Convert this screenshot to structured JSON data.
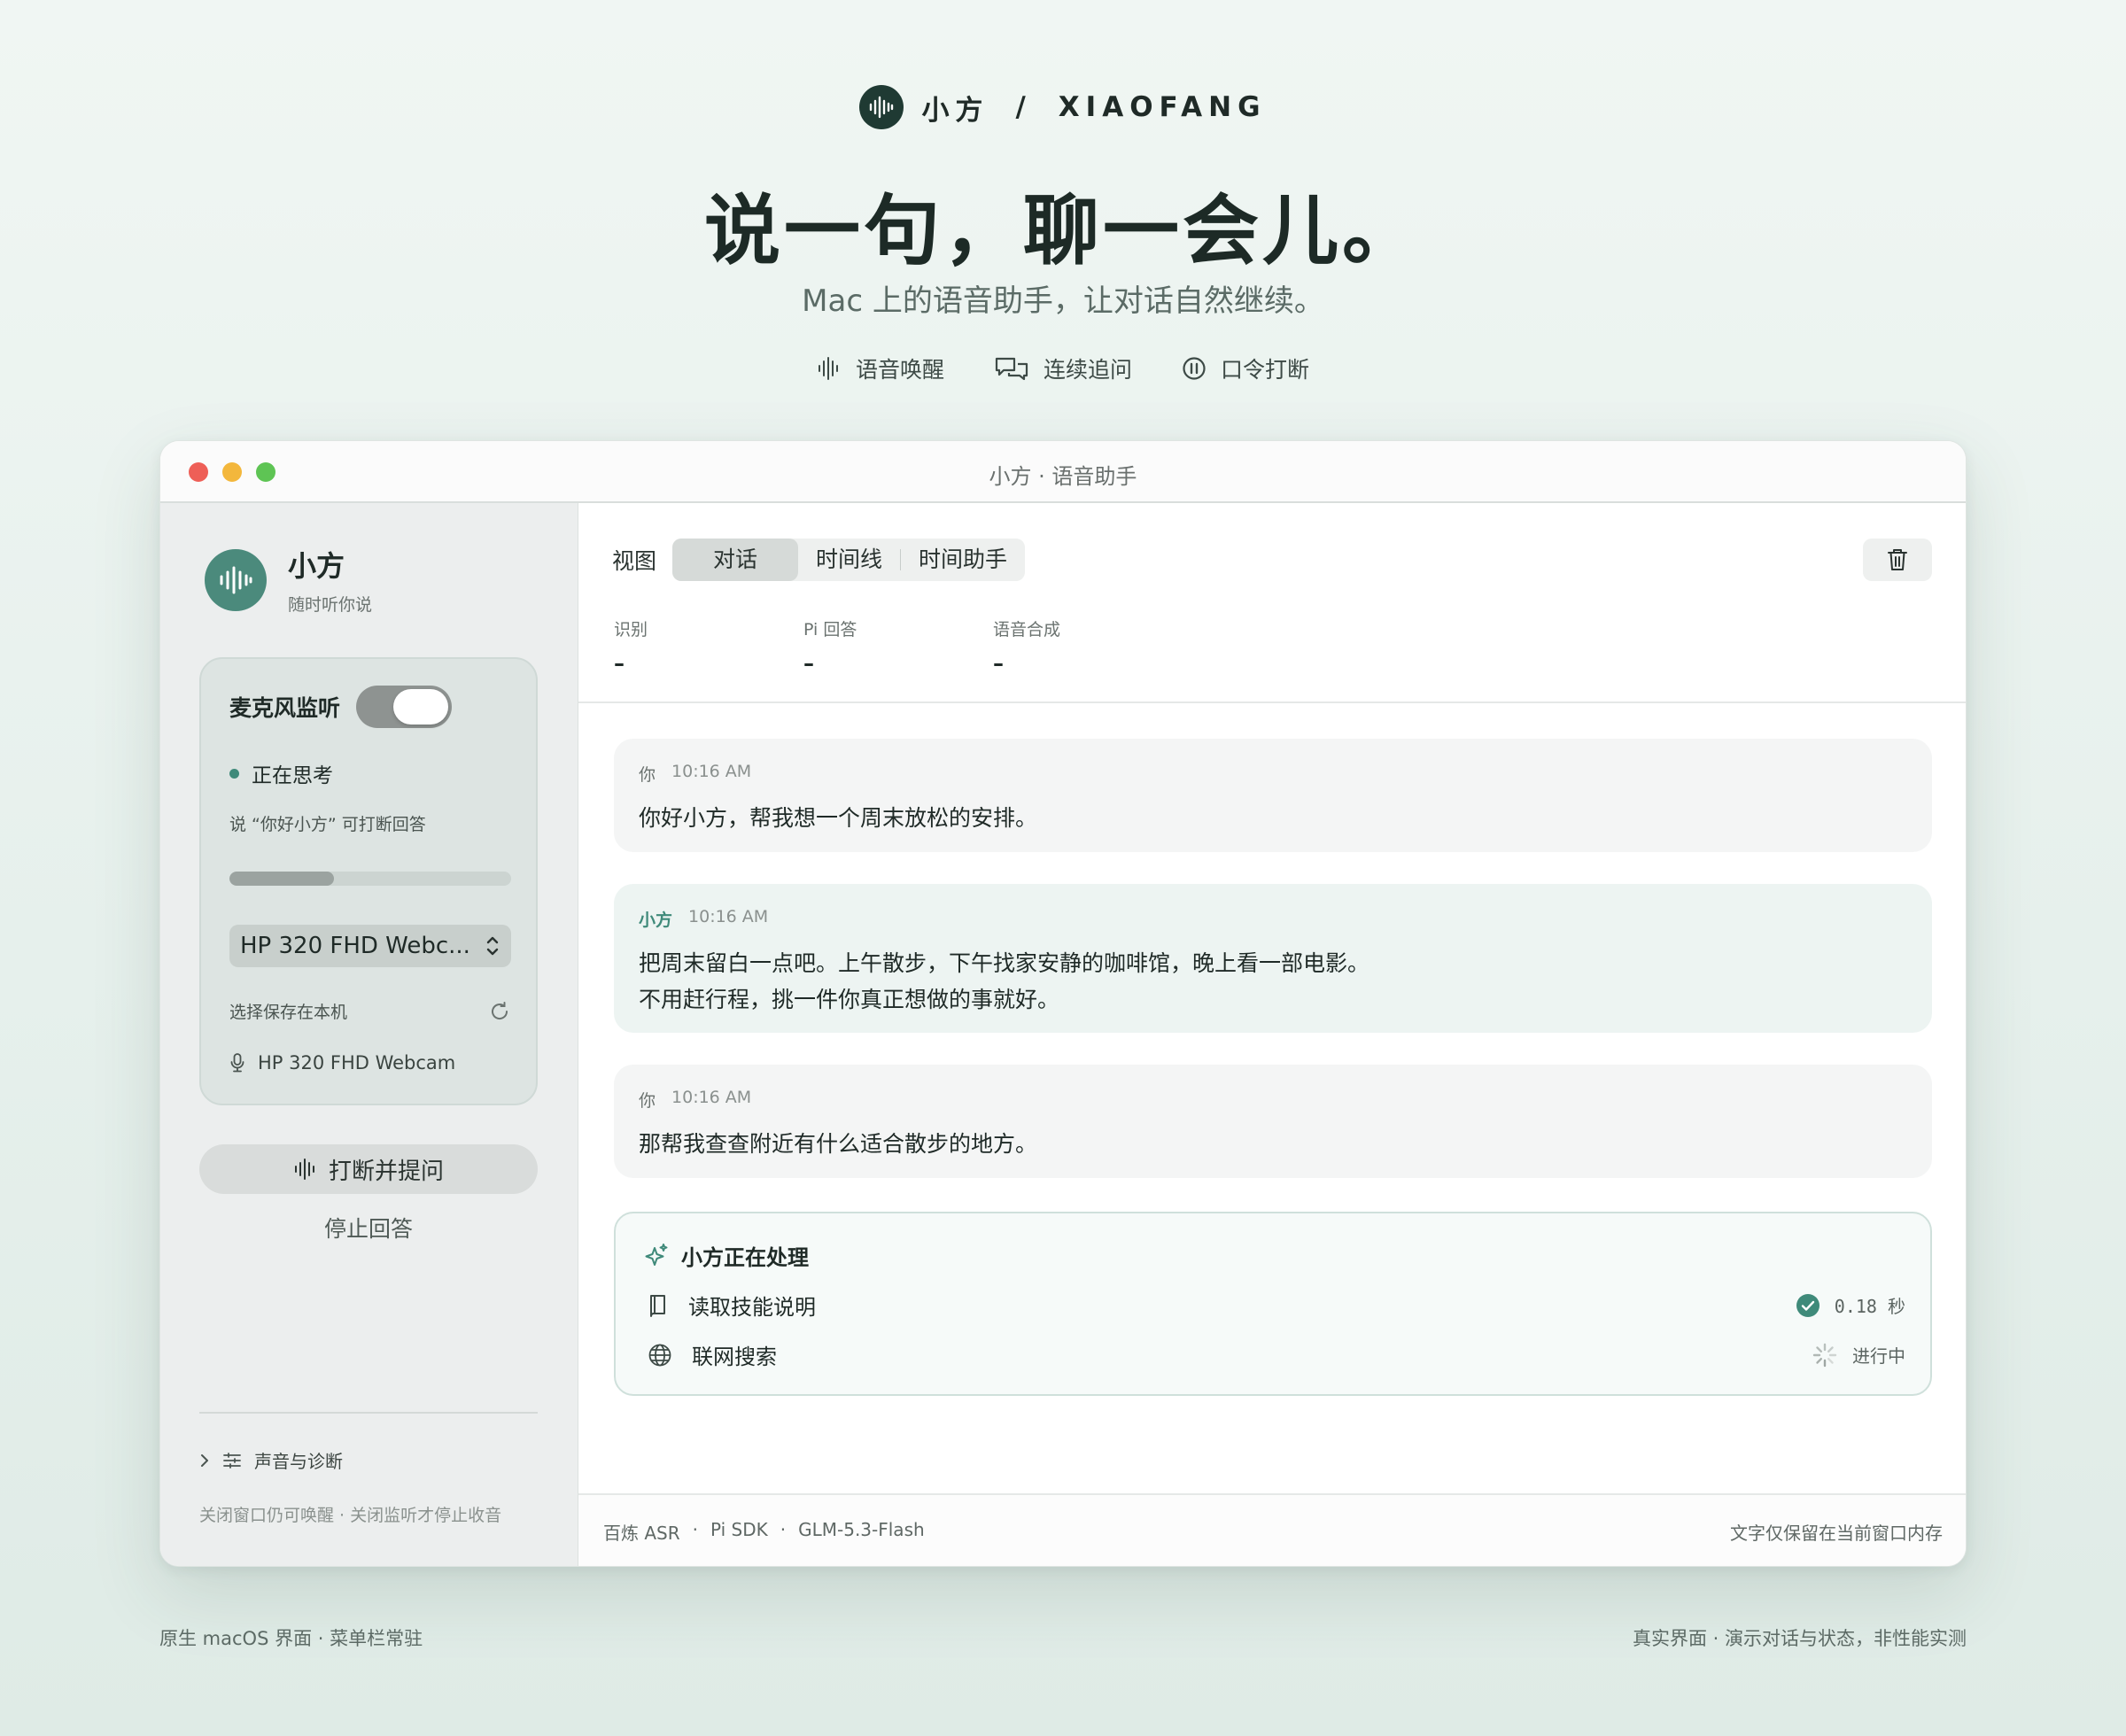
{
  "brand": {
    "name": "小方",
    "separator": "/",
    "latin": "XIAOFANG"
  },
  "hero": {
    "headline": "说一句，聊一会儿。",
    "subline": "Mac 上的语音助手，让对话自然继续。",
    "features": [
      {
        "icon": "waveform-icon",
        "label": "语音唤醒"
      },
      {
        "icon": "chat-bubbles-icon",
        "label": "连续追问"
      },
      {
        "icon": "pause-circle-icon",
        "label": "口令打断"
      }
    ]
  },
  "window": {
    "title": "小方 · 语音助手"
  },
  "sidebar": {
    "app_name": "小方",
    "app_tagline": "随时听你说",
    "mic_label": "麦克风监听",
    "mic_on": true,
    "status": "正在思考",
    "hint": "说 “你好小方” 可打断回答",
    "level": 0.37,
    "device_selected": "HP 320 FHD Webc...",
    "save_label": "选择保存在本机",
    "device_name": "HP 320 FHD Webcam",
    "interrupt_label": "打断并提问",
    "stop_label": "停止回答",
    "diagnostics_label": "声音与诊断",
    "footer_note": "关闭窗口仍可唤醒 · 关闭监听才停止收音"
  },
  "toolbar": {
    "view_label": "视图",
    "tabs": [
      "对话",
      "时间线",
      "时间助手"
    ],
    "active_tab": "对话"
  },
  "metrics": [
    {
      "label": "识别",
      "value": "–"
    },
    {
      "label": "Pi 回答",
      "value": "–"
    },
    {
      "label": "语音合成",
      "value": "–"
    }
  ],
  "messages": [
    {
      "role": "user",
      "who": "你",
      "time": "10:16 AM",
      "lines": [
        "你好小方，帮我想一个周末放松的安排。"
      ]
    },
    {
      "role": "bot",
      "who": "小方",
      "time": "10:16 AM",
      "lines": [
        "把周末留白一点吧。上午散步，下午找家安静的咖啡馆，晚上看一部电影。",
        "不用赶行程，挑一件你真正想做的事就好。"
      ]
    },
    {
      "role": "user",
      "who": "你",
      "time": "10:16 AM",
      "lines": [
        "那帮我查查附近有什么适合散步的地方。"
      ]
    }
  ],
  "processing": {
    "title": "小方正在处理",
    "steps": [
      {
        "icon": "book-icon",
        "label": "读取技能说明",
        "state_icon": "check-circle-icon",
        "status": "0.18 秒"
      },
      {
        "icon": "globe-icon",
        "label": "联网搜索",
        "state_icon": "spinner-icon",
        "status": "进行中"
      }
    ]
  },
  "footer": {
    "stack": [
      "百炼 ASR",
      "·",
      "Pi SDK",
      "·",
      "GLM-5.3-Flash"
    ],
    "privacy": "文字仅保留在当前窗口内存"
  },
  "page_footer": {
    "left": "原生 macOS 界面 · 菜单栏常驻",
    "right": "真实界面 · 演示对话与状态，非性能实测"
  },
  "colors": {
    "accent": "#3f8a7a",
    "logo_dark": "#1f3a33",
    "logo_light": "#4b8a7c"
  }
}
